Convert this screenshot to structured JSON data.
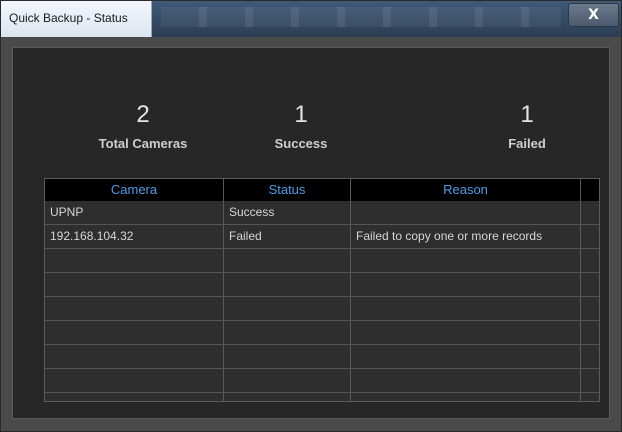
{
  "window": {
    "title": "Quick Backup - Status",
    "close_label": "X"
  },
  "summary": [
    {
      "value": "2",
      "label": "Total Cameras"
    },
    {
      "value": "1",
      "label": "Success"
    },
    {
      "value": "1",
      "label": "Failed"
    }
  ],
  "table": {
    "columns": [
      "Camera",
      "Status",
      "Reason"
    ],
    "rows": [
      {
        "camera": "UPNP",
        "status": "Success",
        "reason": ""
      },
      {
        "camera": "192.168.104.32",
        "status": "Failed",
        "reason": "Failed to copy one or more records"
      },
      {
        "camera": "",
        "status": "",
        "reason": ""
      },
      {
        "camera": "",
        "status": "",
        "reason": ""
      },
      {
        "camera": "",
        "status": "",
        "reason": ""
      },
      {
        "camera": "",
        "status": "",
        "reason": ""
      },
      {
        "camera": "",
        "status": "",
        "reason": ""
      },
      {
        "camera": "",
        "status": "",
        "reason": ""
      }
    ]
  },
  "colors": {
    "header_text": "#4d9de8",
    "panel_bg": "#272727",
    "header_bg": "#000000"
  }
}
